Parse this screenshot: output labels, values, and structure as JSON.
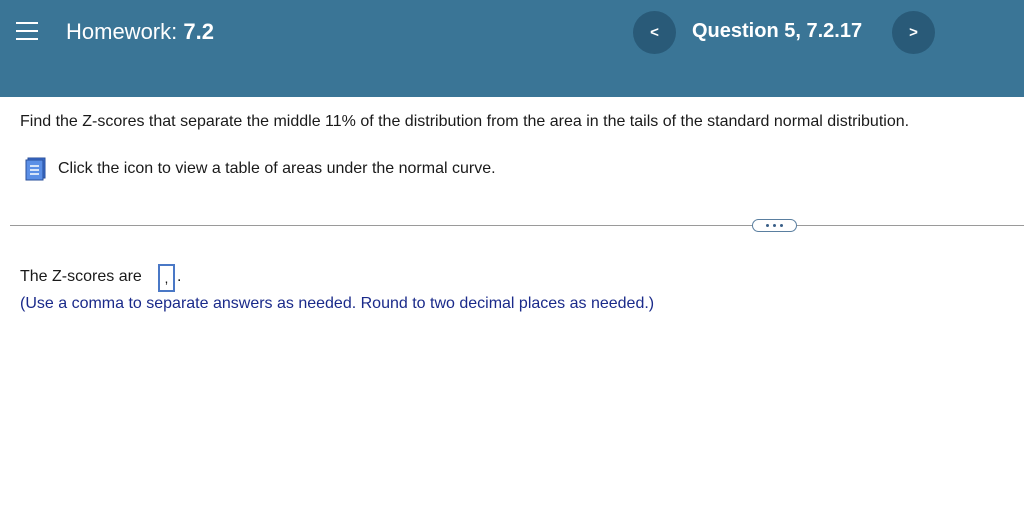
{
  "header": {
    "menu_icon": "hamburger-menu-icon",
    "homework_prefix": "Homework:",
    "homework_number": "7.2",
    "prev_icon": "<",
    "question_label": "Question 5, 7.2.17",
    "next_icon": ">",
    "background_color": "#3a7596"
  },
  "question": {
    "prompt": "Find the Z-scores that separate the middle 11% of the distribution from the area in the tails of the standard normal distribution.",
    "table_link": "Click the icon to view a table of areas under the normal curve.",
    "table_icon": "book-icon"
  },
  "answer": {
    "label": "The Z-scores are",
    "box_value": ",",
    "trailing": ".",
    "hint": "(Use a comma to separate answers as needed. Round to two decimal places as needed.)"
  }
}
